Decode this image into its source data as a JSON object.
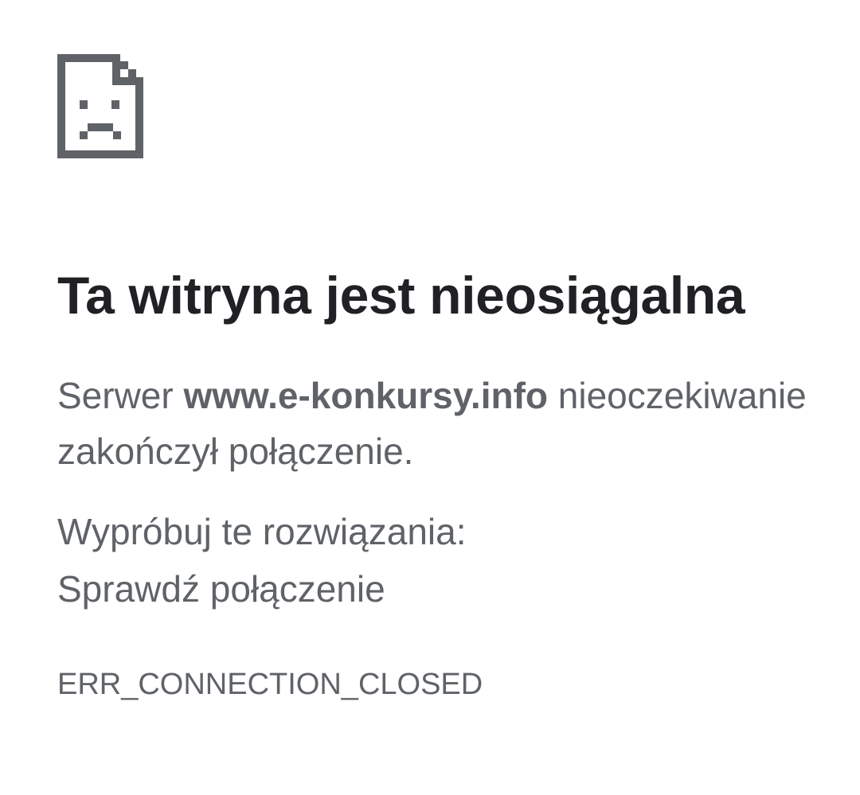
{
  "icon": {
    "name": "sad-page-icon",
    "color": "#5f6368"
  },
  "title": "Ta witryna jest nieosiągalna",
  "message": {
    "prefix": "Serwer ",
    "host": "www.e-konkursy.info",
    "suffix": " nieoczekiwanie zakończył połączenie."
  },
  "suggestions": {
    "heading": "Wypróbuj te rozwiązania:",
    "items": [
      "Sprawdź połączenie"
    ]
  },
  "error_code": "ERR_CONNECTION_CLOSED",
  "colors": {
    "title": "#202124",
    "body_text": "#5f6368",
    "background": "#ffffff"
  }
}
